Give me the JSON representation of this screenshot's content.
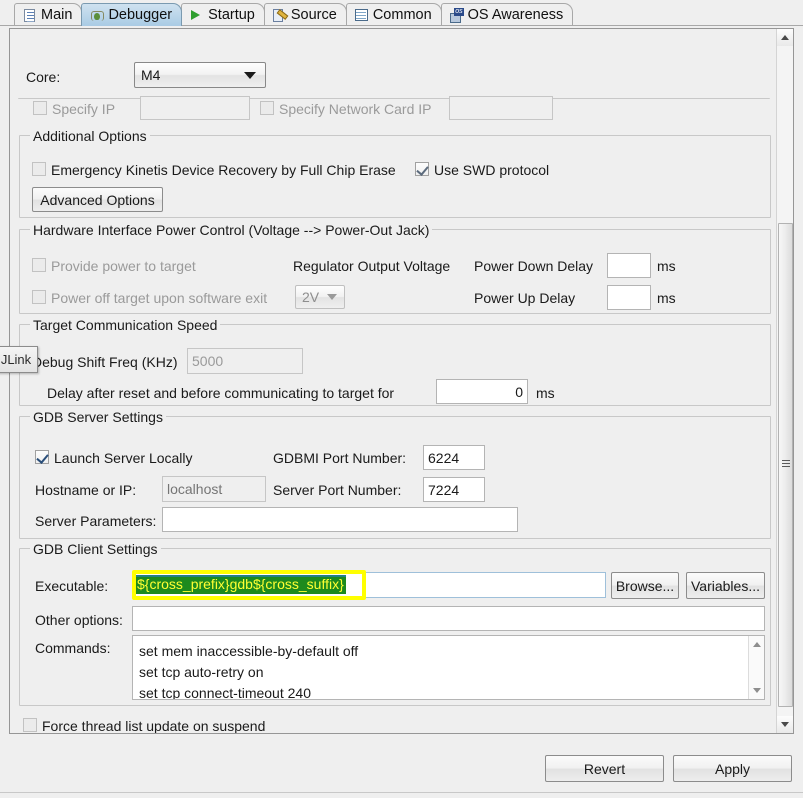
{
  "tabs": [
    {
      "label": "Main",
      "icon": "document-icon",
      "active": false
    },
    {
      "label": "Debugger",
      "icon": "bug-icon",
      "active": true
    },
    {
      "label": "Startup",
      "icon": "play-icon",
      "active": false
    },
    {
      "label": "Source",
      "icon": "source-edit-icon",
      "active": false
    },
    {
      "label": "Common",
      "icon": "table-icon",
      "active": false
    },
    {
      "label": "OS Awareness",
      "icon": "os-icon",
      "active": false
    }
  ],
  "core": {
    "label": "Core:",
    "value": "M4",
    "specify_ip": {
      "label": "Specify IP",
      "checked": false,
      "value": ""
    },
    "specify_network_card_ip": {
      "label": "Specify Network Card IP",
      "checked": false,
      "value": ""
    }
  },
  "additional_options": {
    "title": "Additional Options",
    "emergency_erase": {
      "label": "Emergency Kinetis Device Recovery by Full Chip Erase",
      "checked": false
    },
    "use_swd": {
      "label": "Use SWD protocol",
      "checked": true
    },
    "advanced_button": "Advanced Options"
  },
  "power_control": {
    "title": "Hardware Interface Power Control (Voltage --> Power-Out Jack)",
    "provide_power": {
      "label": "Provide power to target",
      "checked": false
    },
    "power_off_exit": {
      "label": "Power off target upon software exit",
      "checked": false
    },
    "regulator_label": "Regulator Output Voltage",
    "regulator_value": "2V",
    "power_down_delay": {
      "label": "Power Down Delay",
      "value": "",
      "unit": "ms"
    },
    "power_up_delay": {
      "label": "Power Up Delay",
      "value": "",
      "unit": "ms"
    }
  },
  "target_speed": {
    "title": "Target Communication Speed",
    "shift_freq_label": "Debug Shift Freq (KHz)",
    "shift_freq_value": "5000",
    "delay_label": "Delay after reset and before communicating to target for",
    "delay_value": "0",
    "delay_unit": "ms"
  },
  "gdb_server": {
    "title": "GDB Server Settings",
    "launch_locally": {
      "label": "Launch Server Locally",
      "checked": true
    },
    "hostname_label": "Hostname or IP:",
    "hostname_placeholder": "localhost",
    "gdbmi_label": "GDBMI Port Number:",
    "gdbmi_value": "6224",
    "server_port_label": "Server Port Number:",
    "server_port_value": "7224",
    "server_params_label": "Server Parameters:",
    "server_params_value": ""
  },
  "gdb_client": {
    "title": "GDB Client Settings",
    "executable_label": "Executable:",
    "executable_value": "${cross_prefix}gdb${cross_suffix}",
    "browse_button": "Browse...",
    "variables_button": "Variables...",
    "other_options_label": "Other options:",
    "other_options_value": "",
    "commands_label": "Commands:",
    "commands_value": "set mem inaccessible-by-default off\nset tcp auto-retry on\nset tcp connect-timeout 240"
  },
  "force_thread": {
    "label": "Force thread list update on suspend",
    "checked": false
  },
  "footer": {
    "revert": "Revert",
    "apply": "Apply"
  },
  "tooltip": {
    "text": "JLink"
  },
  "colors": {
    "selection_background": "#1d8a1d",
    "selection_text": "#ffff33",
    "highlight_marker": "#ffff00",
    "active_tab": "#b9d4e8"
  }
}
